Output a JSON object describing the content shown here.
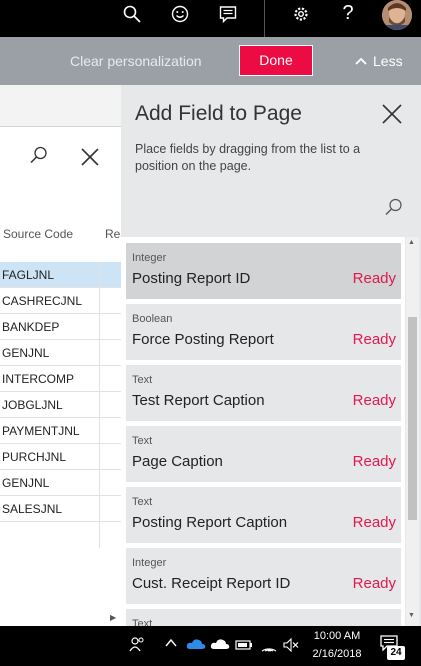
{
  "topbar": {
    "icons": [
      "search-icon",
      "smiley-icon",
      "message-icon",
      "gear-icon",
      "help-icon",
      "avatar"
    ],
    "help_label": "?"
  },
  "personalization_bar": {
    "clear_label": "Clear personalization",
    "done_label": "Done",
    "less_label": "Less"
  },
  "background_page": {
    "column_headers": [
      "Source Code",
      "Rea"
    ],
    "rows": [
      "FAGLJNL",
      "CASHRECJNL",
      "BANKDEP",
      "GENJNL",
      "INTERCOMP",
      "JOBGLJNL",
      "PAYMENTJNL",
      "PURCHJNL",
      "GENJNL",
      "SALESJNL"
    ]
  },
  "panel": {
    "title": "Add Field to Page",
    "hint": "Place fields by dragging from the list to a position on the page.",
    "fields": [
      {
        "type": "Integer",
        "name": "Posting Report ID",
        "status": "Ready"
      },
      {
        "type": "Boolean",
        "name": "Force Posting Report",
        "status": "Ready"
      },
      {
        "type": "Text",
        "name": "Test Report Caption",
        "status": "Ready"
      },
      {
        "type": "Text",
        "name": "Page Caption",
        "status": "Ready"
      },
      {
        "type": "Text",
        "name": "Posting Report Caption",
        "status": "Ready"
      },
      {
        "type": "Integer",
        "name": "Cust. Receipt Report ID",
        "status": "Ready"
      },
      {
        "type": "Text",
        "name": "",
        "status": ""
      }
    ]
  },
  "taskbar": {
    "time": "10:00 AM",
    "date": "2/16/2018",
    "notification_count": "24"
  },
  "colors": {
    "accent": "#ec0b43",
    "ready": "#e01a4f",
    "personalization_bar": "#9aa0a6",
    "panel": "#e7e8ea",
    "selected_row": "#cde4f7"
  }
}
